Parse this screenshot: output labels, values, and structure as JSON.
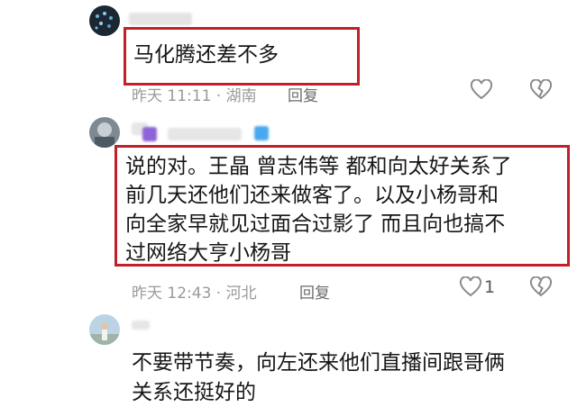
{
  "comments": [
    {
      "text": "马化腾还差不多",
      "time_location": "昨天 11:11 · 湖南",
      "reply_label": "回复"
    },
    {
      "lines": [
        "说的对。王晶 曾志伟等 都和向太好关系了",
        "前几天还他们还来做客了。以及小杨哥和",
        "向全家早就见过面合过影了 而且向也搞不",
        "过网络大亨小杨哥"
      ],
      "time_location": "昨天 12:43 · 河北",
      "reply_label": "回复",
      "like_count": "1"
    },
    {
      "lines": [
        "不要带节奏，向左还来他们直播间跟哥俩",
        "关系还挺好的"
      ]
    }
  ],
  "colors": {
    "highlight": "#c0202a",
    "meta_text": "#9a9a9a"
  },
  "icons": [
    "heart-icon",
    "broken-heart-icon"
  ]
}
